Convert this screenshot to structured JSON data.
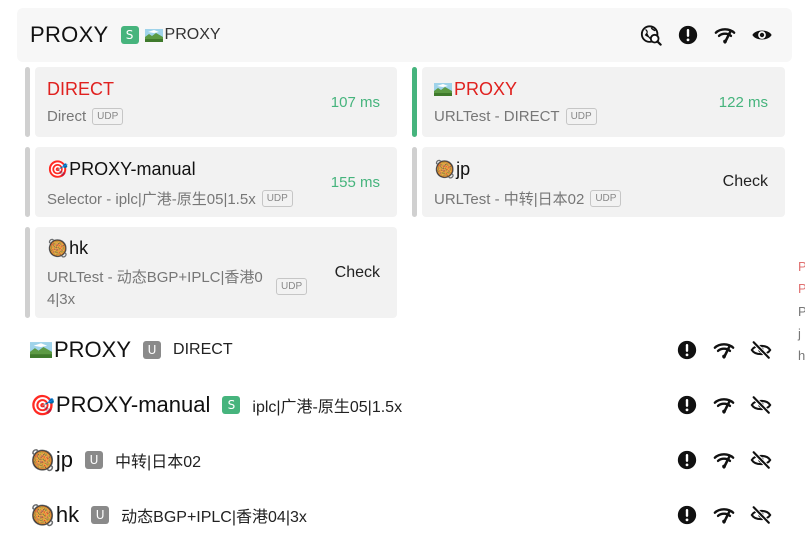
{
  "header": {
    "title": "PROXY",
    "badge": "S",
    "now": "PROXY",
    "icons": [
      "globe-search-icon",
      "alert-icon",
      "wifi-speed-icon",
      "eye-icon"
    ]
  },
  "cards": [
    {
      "name": "DIRECT",
      "type": "Direct",
      "udp": "UDP",
      "delay": "107 ms",
      "active": false,
      "red": true
    },
    {
      "name": "PROXY",
      "type": "URLTest - DIRECT",
      "udp": "UDP",
      "delay": "122 ms",
      "active": true,
      "red": true
    },
    {
      "name": "PROXY-manual",
      "type": "Selector - iplc|广港-原生05|1.5x",
      "udp": "UDP",
      "delay": "155 ms",
      "active": false
    },
    {
      "name": "jp",
      "type": "URLTest - 中转|日本02",
      "udp": "UDP",
      "check": "Check",
      "active": false
    },
    {
      "name": "hk",
      "type_line1": "URLTest - 动态BGP+IPLC|香港0",
      "type_line2": "4|3x",
      "udp": "UDP",
      "check": "Check",
      "active": false
    }
  ],
  "groups": [
    {
      "name": "PROXY",
      "badge": "U",
      "now": "DIRECT"
    },
    {
      "name": "PROXY-manual",
      "badge": "S",
      "now": "iplc|广港-原生05|1.5x"
    },
    {
      "name": "jp",
      "badge": "U",
      "now": "中转|日本02"
    },
    {
      "name": "hk",
      "badge": "U",
      "now": "动态BGP+IPLC|香港04|3x"
    }
  ],
  "edge": [
    "P",
    "P",
    "P",
    "j",
    "h"
  ],
  "emoji": {
    "target": "🎯",
    "bowl": "🥘"
  },
  "colors": {
    "accent": "#46b47d",
    "red": "#e0211f",
    "udp_border": "#c6c6c6"
  }
}
